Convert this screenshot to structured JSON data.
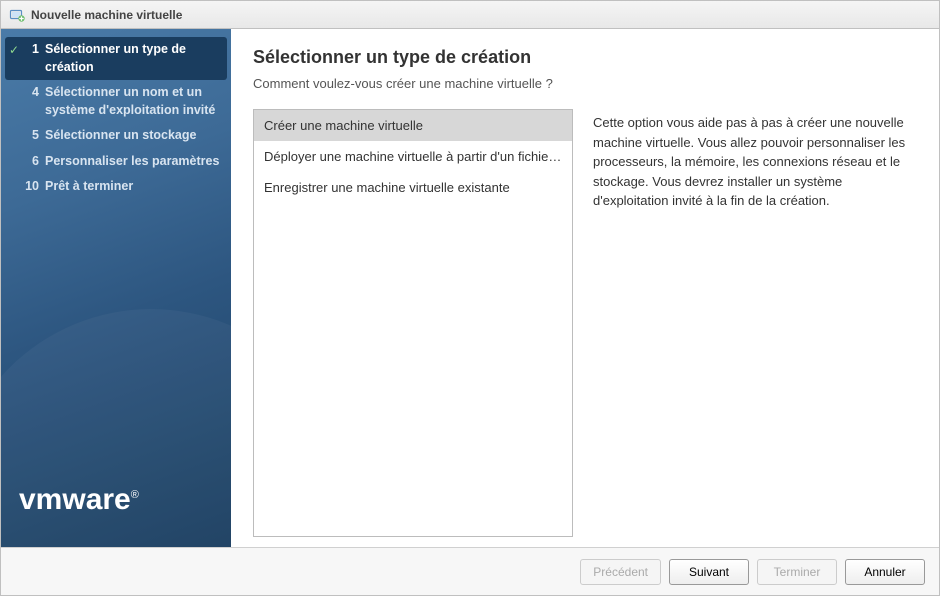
{
  "window": {
    "title": "Nouvelle machine virtuelle"
  },
  "sidebar": {
    "steps": [
      {
        "num": "1",
        "label": "Sélectionner un type de création",
        "active": true,
        "checked": true
      },
      {
        "num": "4",
        "label": "Sélectionner un nom et un système d'exploitation invité"
      },
      {
        "num": "5",
        "label": "Sélectionner un stockage"
      },
      {
        "num": "6",
        "label": "Personnaliser les paramètres"
      },
      {
        "num": "10",
        "label": "Prêt à terminer"
      }
    ],
    "logo": "vmware"
  },
  "main": {
    "title": "Sélectionner un type de création",
    "subtitle": "Comment voulez-vous créer une machine virtuelle ?",
    "options": [
      {
        "label": "Créer une machine virtuelle",
        "selected": true
      },
      {
        "label": "Déployer une machine virtuelle à partir d'un fichier OVF ..."
      },
      {
        "label": "Enregistrer une machine virtuelle existante"
      }
    ],
    "description": "Cette option vous aide pas à pas à créer une nouvelle machine virtuelle. Vous allez pouvoir personnaliser les processeurs, la mémoire, les connexions réseau et le stockage. Vous devrez installer un système d'exploitation invité à la fin de la création."
  },
  "footer": {
    "back": "Précédent",
    "next": "Suivant",
    "finish": "Terminer",
    "cancel": "Annuler"
  }
}
